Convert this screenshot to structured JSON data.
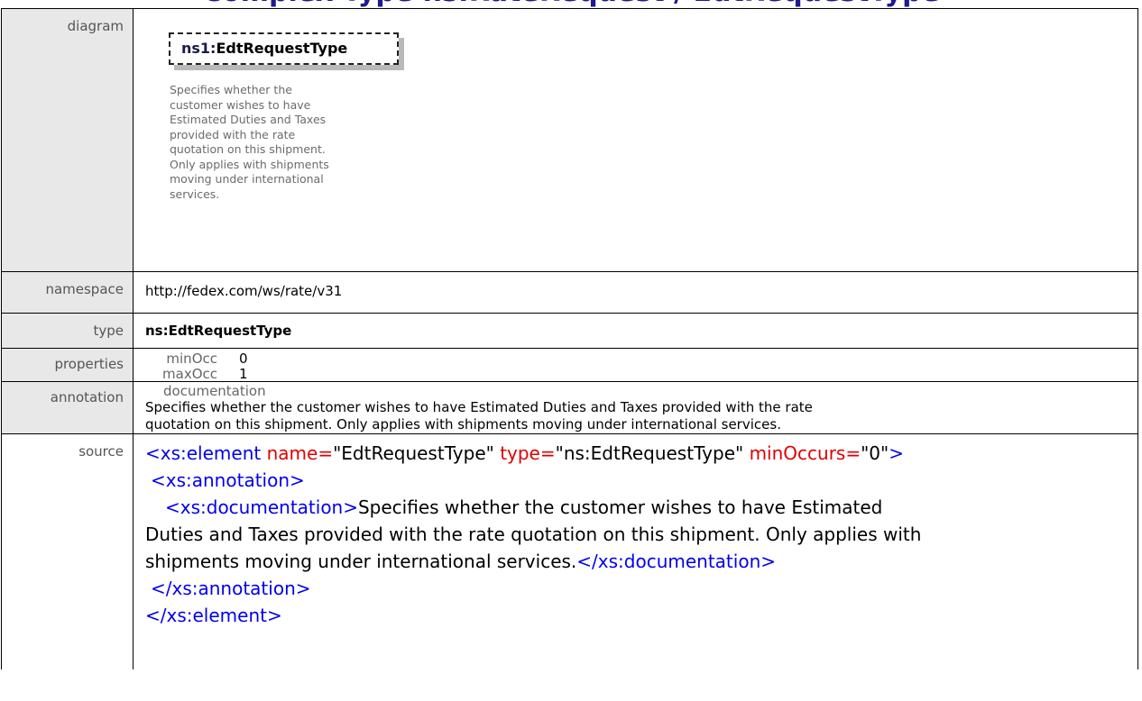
{
  "heading": "Complex Type ns:RateRequest / EdtRequestType",
  "labels": {
    "diagram": "diagram",
    "namespace": "namespace",
    "type": "type",
    "properties": "properties",
    "annotation": "annotation",
    "source": "source"
  },
  "diagram": {
    "prefix": "ns1:",
    "name": "EdtRequestType",
    "doc_lines": [
      "Specifies whether the",
      "customer wishes to have",
      "Estimated Duties and Taxes",
      "provided with the rate",
      "quotation on this shipment.",
      "Only applies with shipments",
      "moving under international",
      "services."
    ]
  },
  "namespace": "http://fedex.com/ws/rate/v31",
  "type": "ns:EdtRequestType",
  "properties": {
    "minOcc_label": "minOcc",
    "minOcc": "0",
    "maxOcc_label": "maxOcc",
    "maxOcc": "1"
  },
  "annotation": {
    "head": "documentation",
    "line1": "Specifies whether the customer wishes to have Estimated Duties and Taxes provided with the rate",
    "line2": "quotation on this shipment. Only applies with shipments moving under international services."
  },
  "source": {
    "l1_open": "<xs:element",
    "l1_name_attr": "name=",
    "l1_name_val": "\"EdtRequestType\"",
    "l1_type_attr": "type=",
    "l1_type_val": "\"ns:EdtRequestType\"",
    "l1_min_attr": "minOccurs=",
    "l1_min_val": "\"0\"",
    "l1_close": ">",
    "l2": "<xs:annotation>",
    "l3_open": "<xs:documentation>",
    "l3_text": "Specifies whether the customer wishes to have Estimated",
    "l4_text": "Duties and Taxes provided with the rate quotation on this shipment. Only applies with",
    "l5_text": "shipments moving under international services.",
    "l5_close": "</xs:documentation>",
    "l6": "</xs:annotation>",
    "l7": "</xs:element>"
  }
}
